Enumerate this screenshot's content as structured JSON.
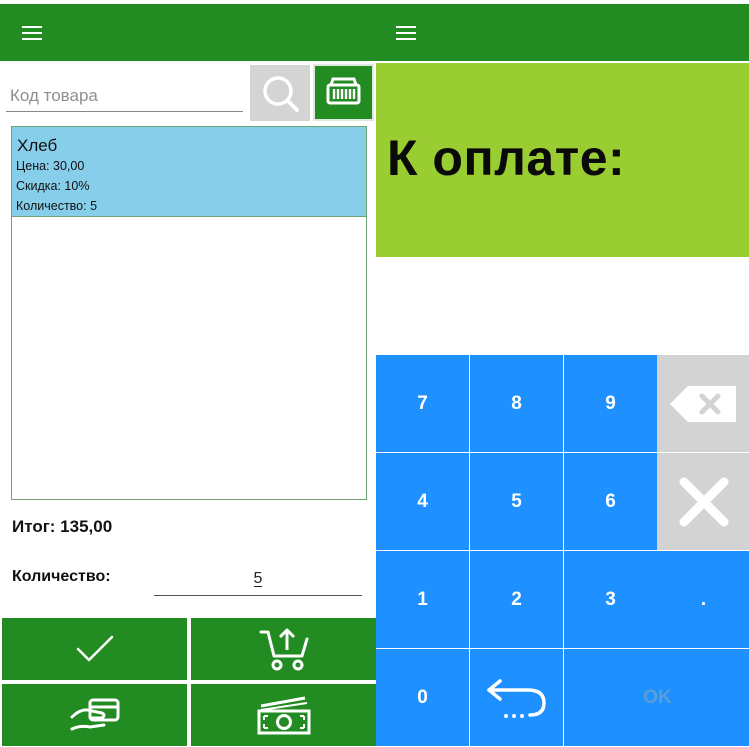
{
  "cart_screen": {
    "search": {
      "placeholder": "Код товара"
    },
    "items": [
      {
        "name": "Хлеб",
        "price": "Цена: 30,00",
        "discount": "Скидка: 10%",
        "quantity": "Количество: 5"
      }
    ],
    "total": "Итог: 135,00",
    "quantity_label": "Количество:",
    "quantity_value": "5",
    "actions": [
      {
        "icon": "checkmark-icon"
      },
      {
        "icon": "cart-upload-icon"
      },
      {
        "icon": "hand-card-icon"
      },
      {
        "icon": "cash-icon"
      }
    ]
  },
  "payment_screen": {
    "label": "К оплате:",
    "amount": "",
    "keys": {
      "k7": "7",
      "k8": "8",
      "k9": "9",
      "k4": "4",
      "k5": "5",
      "k6": "6",
      "k1": "1",
      "k2": "2",
      "k3": "3",
      "dot": ".",
      "k0": "0",
      "ok": "OK"
    },
    "icons": [
      "backspace-icon",
      "clear-icon",
      "return-icon"
    ]
  },
  "colors": {
    "appbar": "#228B22",
    "selected_item": "#87CEEB",
    "pay_banner": "#9ACD32",
    "keypad": "#1E90FF",
    "keypad_gray": "#D3D3D3"
  }
}
